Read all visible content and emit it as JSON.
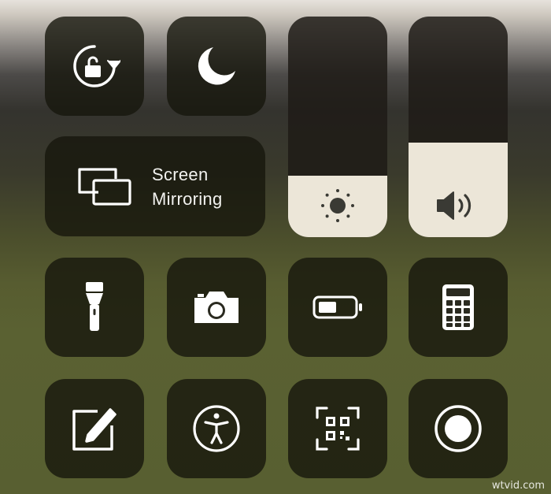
{
  "control_center": {
    "orientation_lock": {
      "icon": "orientation-lock-icon"
    },
    "do_not_disturb": {
      "icon": "moon-icon"
    },
    "screen_mirroring": {
      "icon": "screen-mirroring-icon",
      "label_line1": "Screen",
      "label_line2": "Mirroring"
    },
    "brightness": {
      "icon": "sun-icon",
      "level": 0.28
    },
    "volume": {
      "icon": "speaker-icon",
      "level": 0.43
    },
    "row3": [
      {
        "icon": "flashlight-icon"
      },
      {
        "icon": "camera-icon"
      },
      {
        "icon": "low-power-battery-icon"
      },
      {
        "icon": "calculator-icon"
      }
    ],
    "row4": [
      {
        "icon": "notes-icon"
      },
      {
        "icon": "accessibility-icon"
      },
      {
        "icon": "qr-code-scanner-icon"
      },
      {
        "icon": "screen-recording-icon"
      }
    ]
  },
  "watermark": "wtvid.com",
  "colors": {
    "tile_background": "#16160c",
    "slider_fill": "#ece6d8",
    "icon": "#ffffff"
  }
}
